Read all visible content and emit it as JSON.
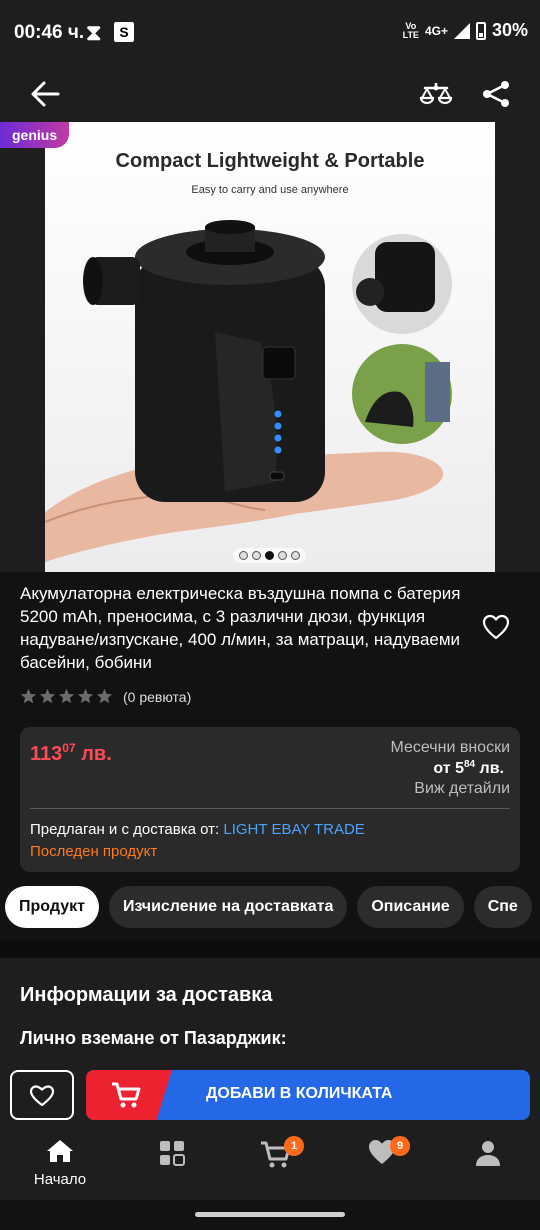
{
  "status_bar": {
    "time": "00:46 ч.",
    "icon_x": "⧗",
    "icon_s": "S",
    "volte_top": "Vo",
    "volte_bottom": "LTE",
    "network": "4G+",
    "battery": "30%"
  },
  "topbar": {
    "back_icon": "arrow-left-icon",
    "compare_icon": "scale-compare-icon",
    "share_icon": "share-icon"
  },
  "gallery": {
    "badge": "genius",
    "title": "Compact Lightweight & Portable",
    "subtitle": "Easy to carry and use anywhere",
    "dots_total": 5,
    "dots_active": 3
  },
  "product": {
    "title": "Акумулаторна електрическа въздушна помпа с батерия 5200 mAh, преносима, с 3 различни дюзи, функция надуване/изпускане, 400 л/мин, за матраци, надуваеми басейни, бобини",
    "rating_stars": 0,
    "reviews": "(0 ревюта)"
  },
  "price": {
    "whole": "113",
    "fraction": "07",
    "currency": "лв.",
    "monthly_label": "Месечни вноски",
    "monthly_prefix": "от 5",
    "monthly_fraction": "84",
    "monthly_currency": "лв.",
    "details": "Виж детайли",
    "seller_prefix": "Предлаган и с доставка от:",
    "seller_name": "LIGHT EBAY TRADE",
    "last_product": "Последен продукт",
    "price_color": "#ff4b55",
    "link_color": "#4aa3ff",
    "warning_color": "#ff7a1a"
  },
  "tabs": [
    {
      "label": "Продукт",
      "active": true
    },
    {
      "label": "Изчисление на доставката",
      "active": false
    },
    {
      "label": "Описание",
      "active": false
    },
    {
      "label": "Спе",
      "active": false
    }
  ],
  "delivery": {
    "title": "Информации за доставка",
    "pickup": "Лично вземане от Пазарджик:"
  },
  "actions": {
    "add_to_cart": "ДОБАВИ В КОЛИЧКАТА",
    "cart_color": "#ec2230",
    "button_color": "#2468e8"
  },
  "nav": {
    "home": "Начало",
    "cart_badge": "1",
    "favorites_badge": "9"
  }
}
